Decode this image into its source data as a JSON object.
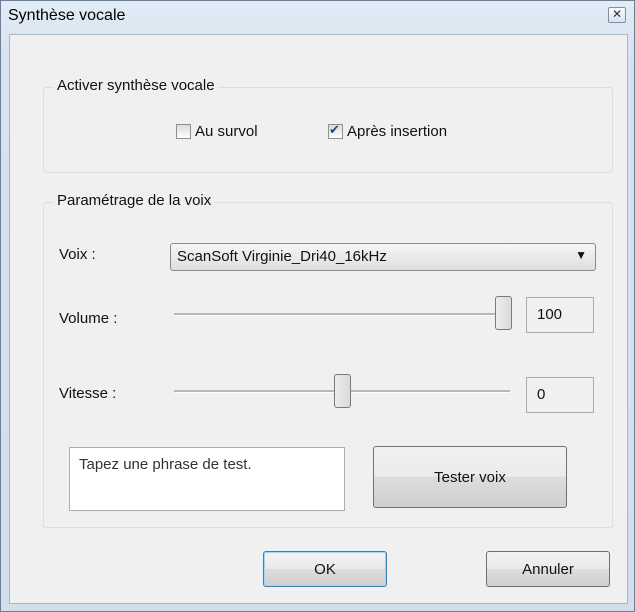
{
  "window": {
    "title": "Synthèse vocale",
    "close_icon": "close-icon"
  },
  "activate_group": {
    "title": "Activer synthèse vocale",
    "hover_label": "Au survol",
    "hover_checked": false,
    "after_insert_label": "Après insertion",
    "after_insert_checked": true
  },
  "voice_group": {
    "title": "Paramétrage de la voix",
    "voice_label": "Voix :",
    "voice_value": "ScanSoft Virginie_Dri40_16kHz",
    "volume_label": "Volume :",
    "volume_value": "100",
    "speed_label": "Vitesse :",
    "speed_value": "0",
    "test_placeholder": "Tapez une phrase de test.",
    "test_button": "Tester voix"
  },
  "buttons": {
    "ok": "OK",
    "cancel": "Annuler"
  }
}
